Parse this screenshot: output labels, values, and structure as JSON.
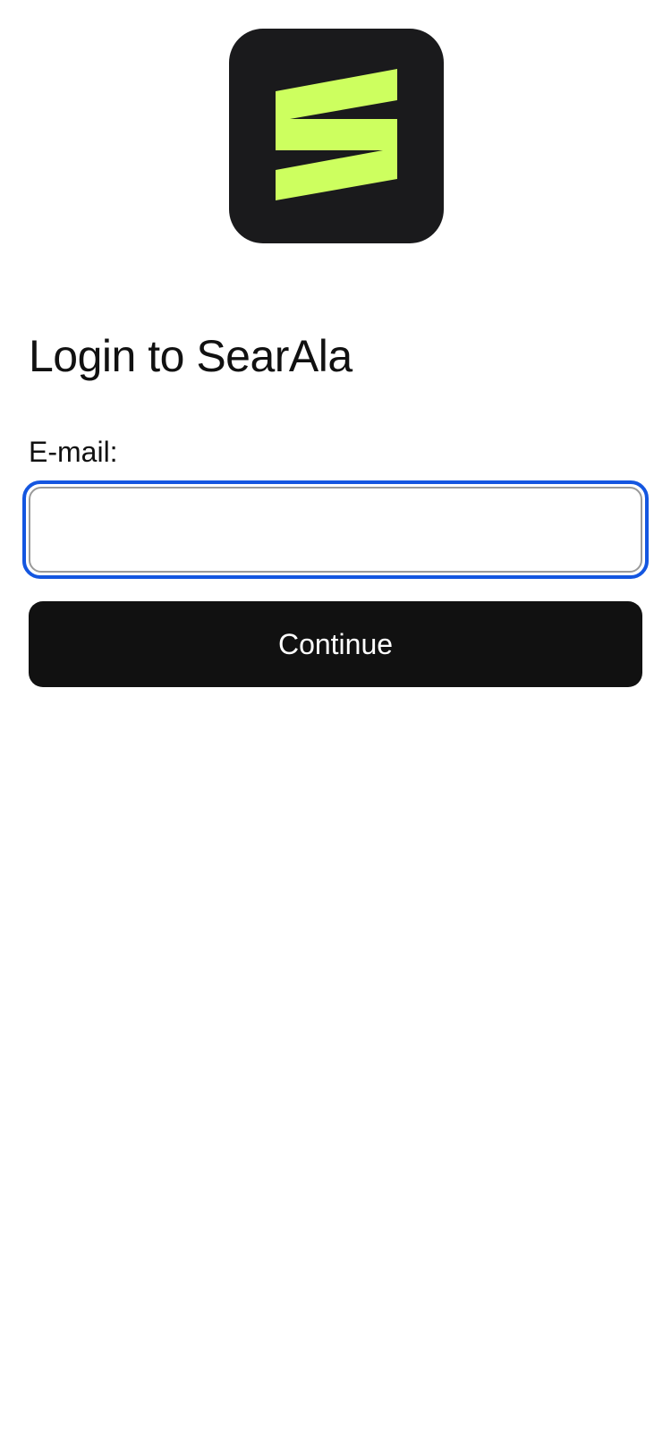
{
  "app": {
    "logo_icon": "searala-logo-icon",
    "logo_colors": {
      "background": "#1a1a1c",
      "mark": "#cdff5f"
    }
  },
  "login": {
    "title": "Login to SearAla",
    "email_label": "E-mail:",
    "email_value": "",
    "email_placeholder": "",
    "continue_label": "Continue"
  },
  "colors": {
    "focus_ring": "#1456e0",
    "button_background": "#111111",
    "button_text": "#ffffff"
  }
}
